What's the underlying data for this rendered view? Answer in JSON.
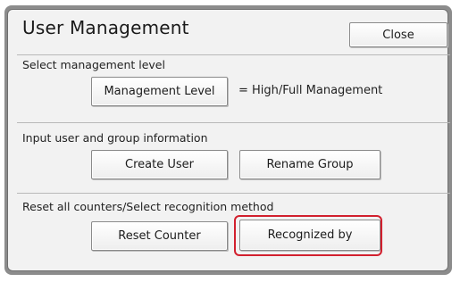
{
  "dialog": {
    "title": "User Management",
    "close_label": "Close"
  },
  "management_level": {
    "section_label": "Select management level",
    "button_label": "Management Level",
    "value_text": "=  High/Full Management"
  },
  "user_group": {
    "section_label": "Input user and group information",
    "create_user_label": "Create User",
    "rename_group_label": "Rename Group"
  },
  "reset": {
    "section_label": "Reset all counters/Select recognition method",
    "reset_counter_label": "Reset Counter",
    "recognized_by_label": "Recognized by"
  },
  "colors": {
    "highlight": "#d2202e",
    "frame": "#8c8c8c",
    "panel": "#f2f2f2"
  }
}
